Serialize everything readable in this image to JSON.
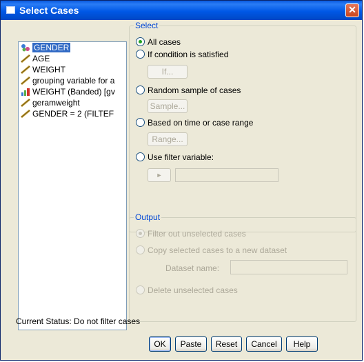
{
  "window": {
    "title": "Select Cases",
    "close_glyph": "✕"
  },
  "variables": [
    {
      "label": "GENDER",
      "icon": "nominal-icon",
      "selected": true
    },
    {
      "label": "AGE",
      "icon": "scale-icon"
    },
    {
      "label": "WEIGHT",
      "icon": "scale-icon"
    },
    {
      "label": "grouping variable for a",
      "icon": "scale-icon"
    },
    {
      "label": "WEIGHT (Banded) [gv",
      "icon": "ordinal-icon"
    },
    {
      "label": "geramweight",
      "icon": "scale-icon"
    },
    {
      "label": "GENDER = 2 (FILTEF",
      "icon": "scale-icon"
    }
  ],
  "select": {
    "title": "Select",
    "all_cases": "All cases",
    "if_condition": "If condition is satisfied",
    "if_button": "If...",
    "random_sample": "Random sample of cases",
    "sample_button": "Sample...",
    "time_range": "Based on time or case range",
    "range_button": "Range...",
    "filter_variable": "Use filter variable:",
    "arrow_glyph": "►",
    "filter_value": ""
  },
  "output": {
    "title": "Output",
    "filter_out": "Filter out unselected cases",
    "copy_selected": "Copy selected cases to a new dataset",
    "dataset_name_label": "Dataset name:",
    "dataset_name_value": "",
    "delete_unselected": "Delete unselected cases"
  },
  "status": "Current Status: Do not filter cases",
  "buttons": {
    "ok": "OK",
    "paste": "Paste",
    "reset": "Reset",
    "cancel": "Cancel",
    "help": "Help"
  },
  "colors": {
    "titlebar": "#0058e6",
    "group_title": "#0046d5",
    "selection": "#316ac5",
    "radio_on": "#21a121"
  }
}
